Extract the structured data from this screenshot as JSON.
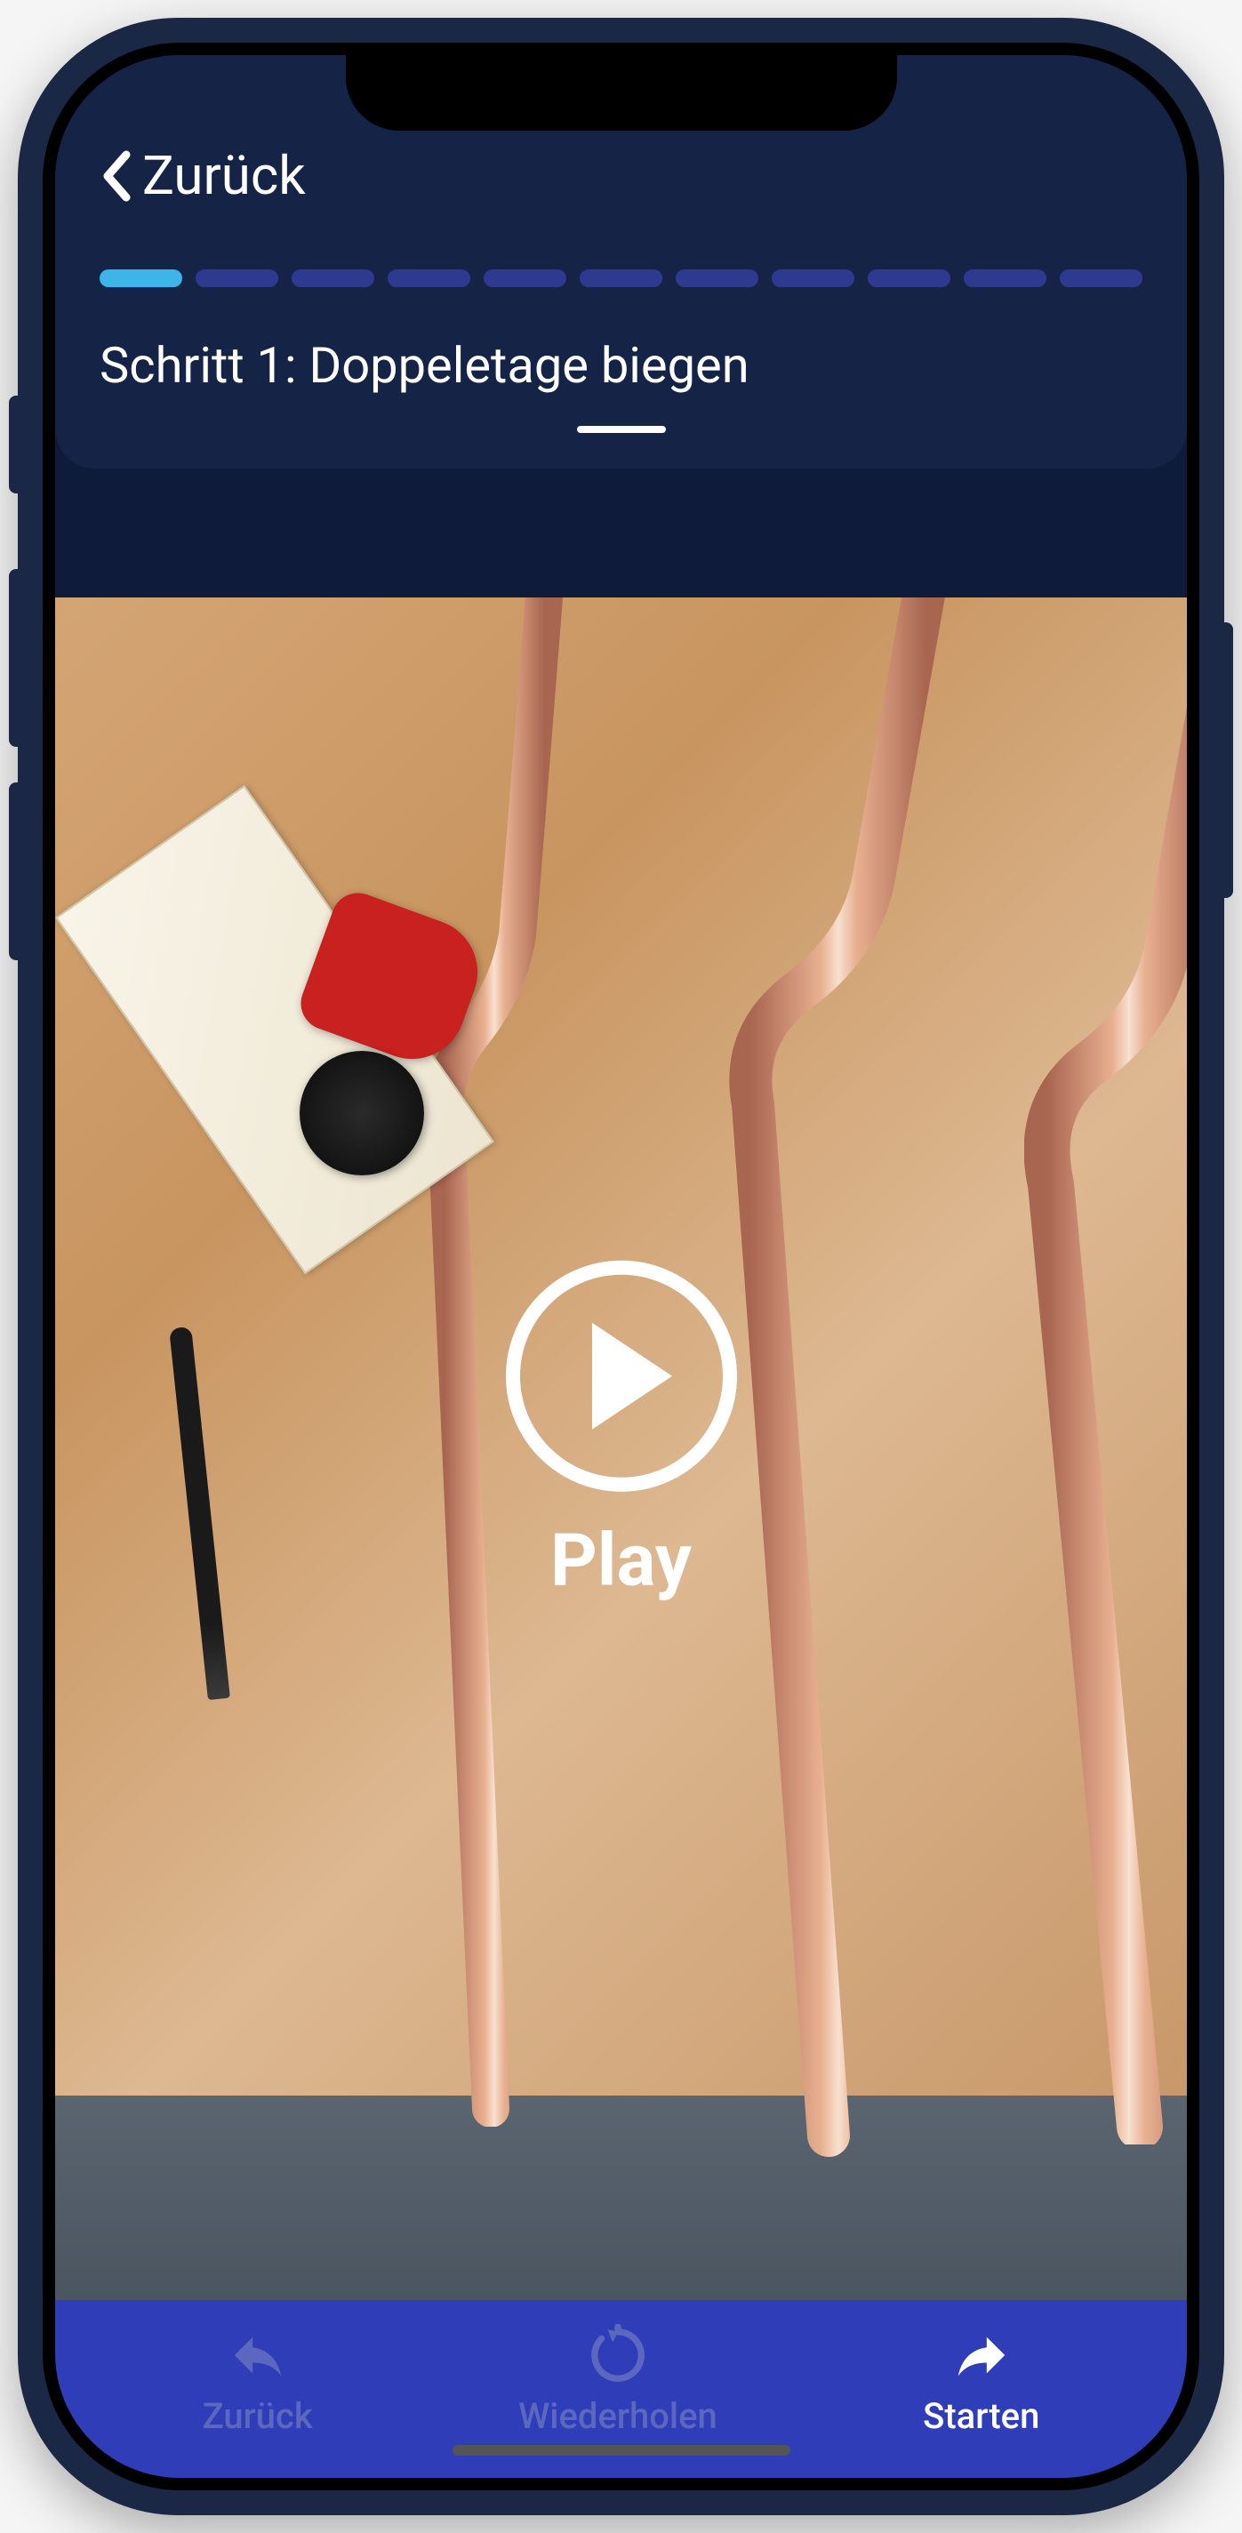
{
  "header": {
    "back_label": "Zurück",
    "step_title": "Schritt 1: Doppeletage biegen"
  },
  "progress": {
    "total_segments": 11,
    "active_index": 0
  },
  "video": {
    "play_label": "Play"
  },
  "bottom_nav": {
    "items": [
      {
        "label": "Zurück",
        "icon": "reply-arrow-icon",
        "active": false
      },
      {
        "label": "Wiederholen",
        "icon": "refresh-icon",
        "active": false
      },
      {
        "label": "Starten",
        "icon": "forward-arrow-icon",
        "active": true
      }
    ]
  }
}
